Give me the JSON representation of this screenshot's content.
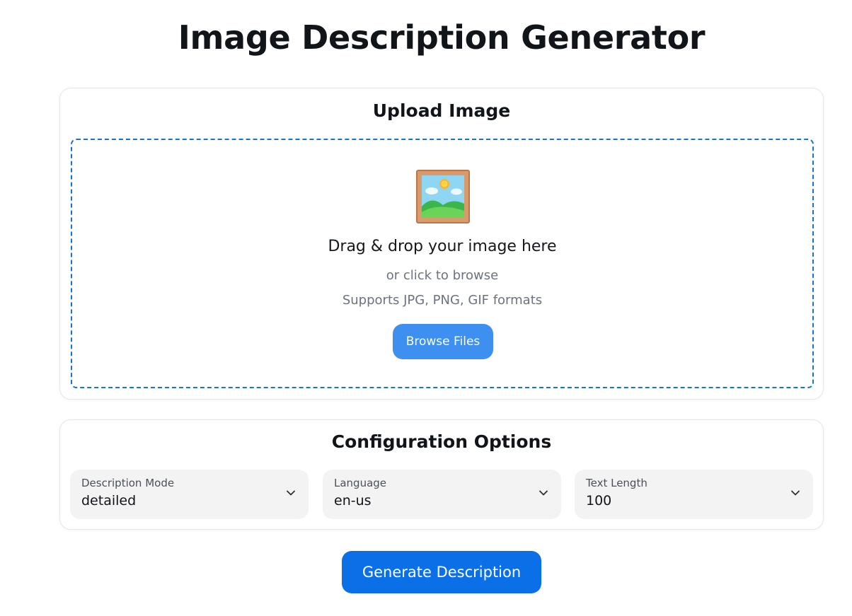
{
  "header": {
    "title": "Image Description Generator"
  },
  "upload": {
    "title": "Upload Image",
    "drop_main": "Drag & drop your image here",
    "drop_sub": "or click to browse",
    "formats": "Supports JPG, PNG, GIF formats",
    "browse_label": "Browse Files",
    "icon": "framed-picture-icon"
  },
  "config": {
    "title": "Configuration Options",
    "fields": [
      {
        "label": "Description Mode",
        "value": "detailed"
      },
      {
        "label": "Language",
        "value": "en-us"
      },
      {
        "label": "Text Length",
        "value": "100"
      }
    ]
  },
  "actions": {
    "generate_label": "Generate Description"
  },
  "colors": {
    "primary": "#0b6fe8",
    "browse_button": "#3d8ff0",
    "dropzone_border": "#1a73c8",
    "muted_text": "#6b7280",
    "select_background": "#f3f3f4"
  }
}
